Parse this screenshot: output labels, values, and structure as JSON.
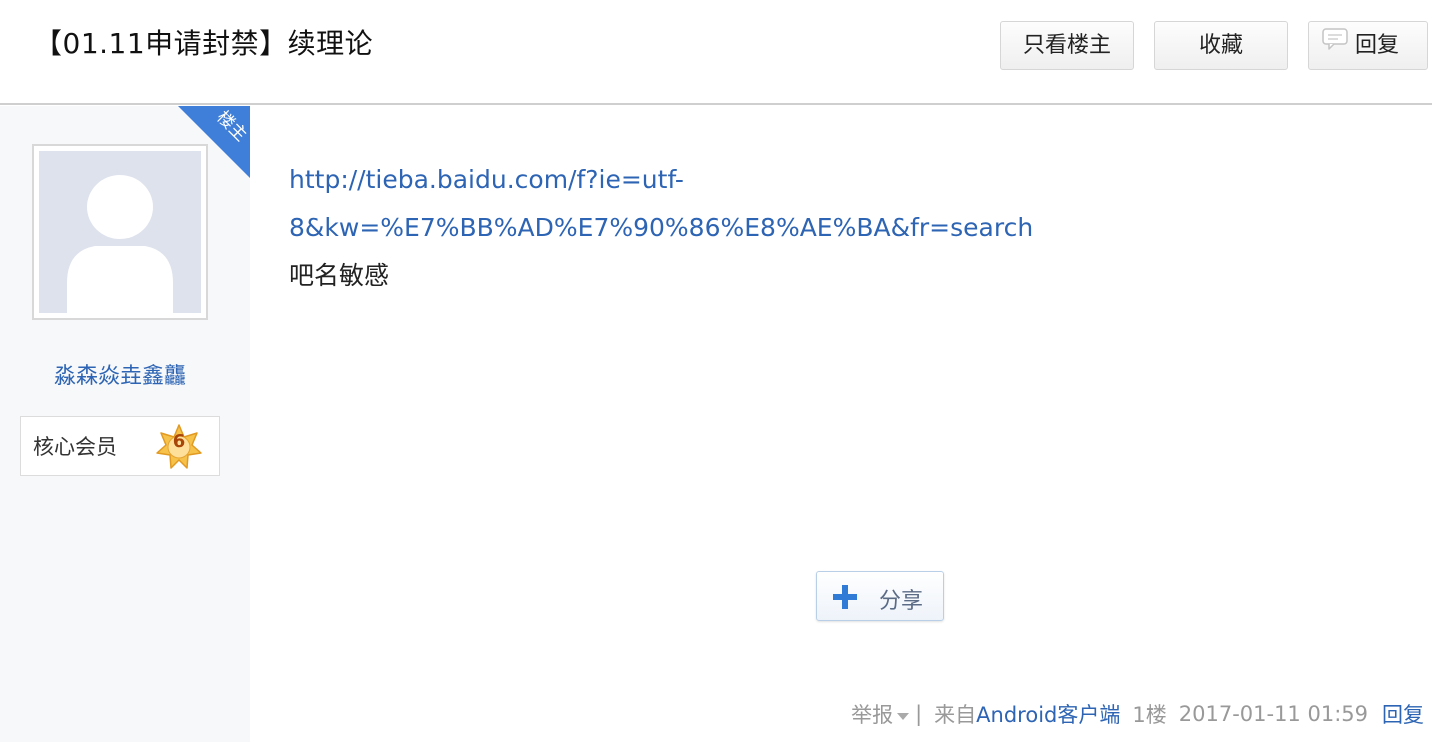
{
  "thread": {
    "title": "【01.11申请封禁】续理论"
  },
  "header": {
    "only_op_label": "只看楼主",
    "favorite_label": "收藏",
    "reply_label": "回复"
  },
  "author": {
    "op_badge": "楼主",
    "username": "淼森焱垚鑫龘",
    "level_title": "核心会员",
    "level": "6"
  },
  "post": {
    "link_line1": "http://tieba.baidu.com/f?ie=utf-",
    "link_line2": "8&kw=%E7%BB%AD%E7%90%86%E8%AE%BA&fr=search",
    "text": "吧名敏感",
    "share_label": "分享"
  },
  "meta": {
    "report_label": "举报",
    "separator": "|",
    "from_prefix": "来自",
    "client_label": "Android客户端",
    "floor": "1楼",
    "timestamp": "2017-01-11 01:59",
    "reply_label": "回复"
  },
  "colors": {
    "link": "#2d64b3",
    "op_corner": "#3f7fd9",
    "level_badge": "#f2b43c"
  }
}
